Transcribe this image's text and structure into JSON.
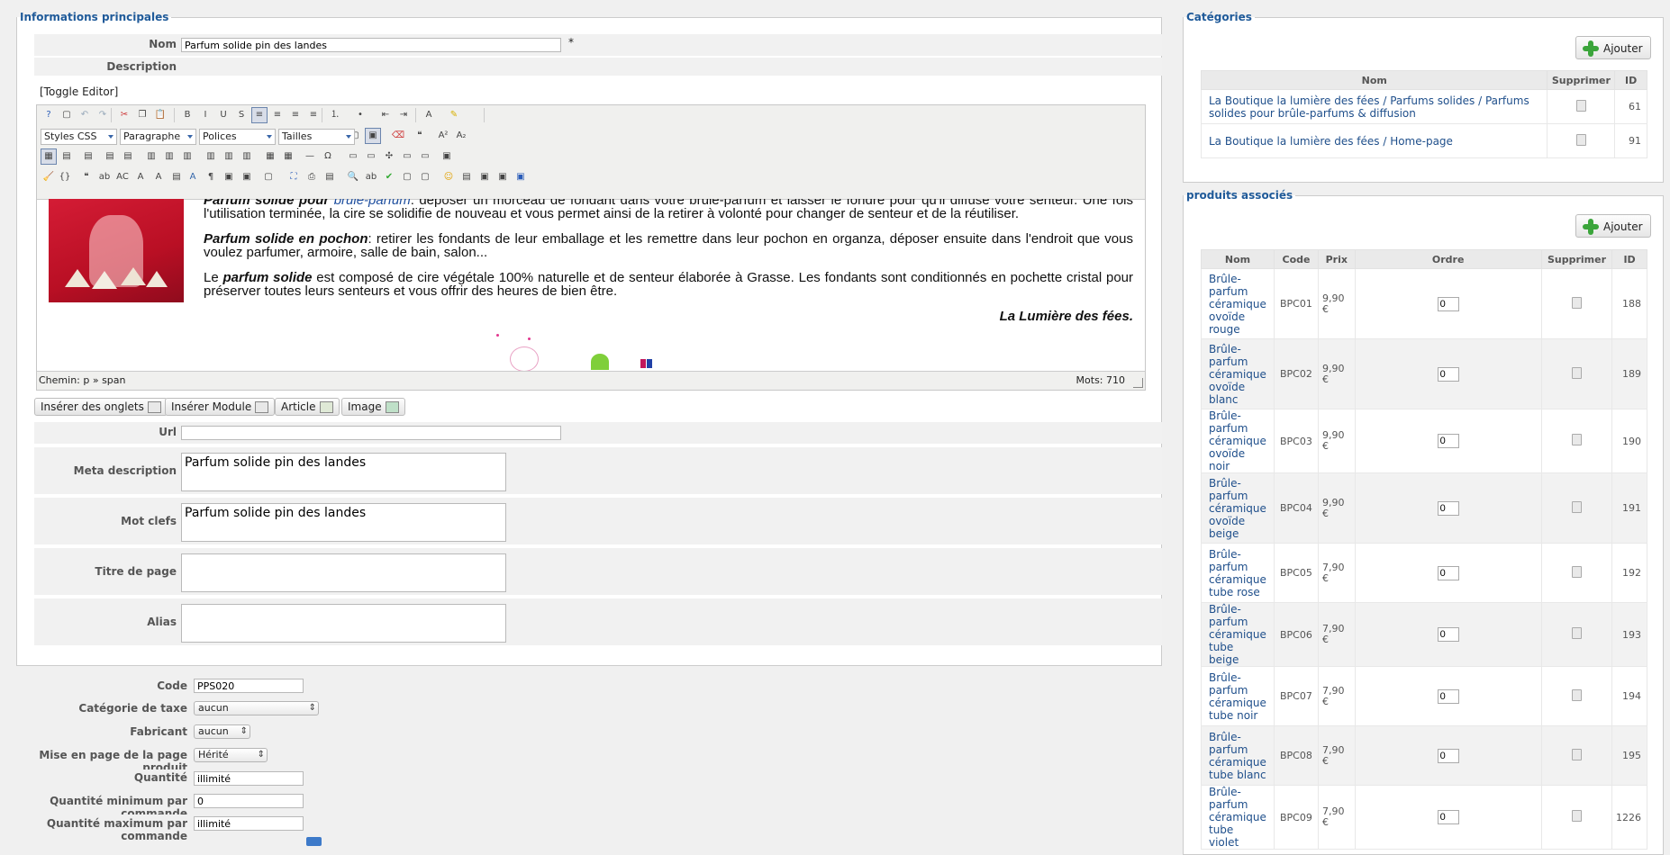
{
  "main": {
    "legend": "Informations principales",
    "nom_label": "Nom",
    "nom_value": "Parfum solide pin des landes",
    "required_mark": "*",
    "description_label": "Description",
    "toggle_editor": "[Toggle Editor]",
    "toolbar_selects": {
      "styles": "Styles CSS",
      "format": "Paragraphe",
      "fonts": "Polices",
      "sizes": "Tailles"
    },
    "content": {
      "p1_bold": "Parfum solide pour ",
      "p1_link": "brûle-parfum",
      "p1_rest": ": déposer un morceau de fondant dans votre brûle-parfum et laisser le fondre pour qu'il diffuse votre senteur. Une fois l'utilisation terminée, la cire se solidifie de nouveau et vous permet ainsi de la retirer à volonté pour changer de senteur et de la réutiliser.",
      "p2_bold": "Parfum solide en pochon",
      "p2_rest": ": retirer les fondants de leur emballage et les remettre dans leur pochon en organza, déposer ensuite dans l'endroit que vous voulez parfumer, armoire, salle de bain, salon...",
      "p3_a": "Le ",
      "p3_bold": "parfum solide",
      "p3_rest": " est composé de cire végétale 100% naturelle et de senteur élaborée à Grasse. Les fondants sont conditionnés en pochette cristal pour préserver toutes leurs senteurs et vous offrir des heures de bien être.",
      "signature": "La Lumière des fées."
    },
    "status_path": "Chemin: p » span",
    "word_count": "Mots: 710",
    "insert_buttons": [
      "Insérer des onglets",
      "Insérer Module",
      "Article",
      "Image"
    ],
    "url_label": "Url",
    "url_value": "",
    "meta_description_label": "Meta description",
    "meta_description_value": "Parfum solide pin des landes",
    "keywords_label": "Mot clefs",
    "keywords_value": "Parfum solide pin des landes",
    "page_title_label": "Titre de page",
    "page_title_value": "",
    "alias_label": "Alias",
    "alias_value": ""
  },
  "details": {
    "code_label": "Code",
    "code_value": "PPS020",
    "tax_label": "Catégorie de taxe",
    "tax_value": "aucun",
    "maker_label": "Fabricant",
    "maker_value": "aucun",
    "layout_label": "Mise en page de la page produit",
    "layout_value": "Hérité",
    "qty_label": "Quantité",
    "qty_value": "illimité",
    "qty_min_label": "Quantité minimum par commande",
    "qty_min_value": "0",
    "qty_max_label": "Quantité maximum par commande",
    "qty_max_value": "illimité"
  },
  "categories": {
    "legend": "Catégories",
    "add_label": "Ajouter",
    "headers": [
      "Nom",
      "Supprimer",
      "ID"
    ],
    "rows": [
      {
        "name": "La Boutique la lumière des fées / Parfums solides / Parfums solides pour brûle-parfums & diffusion",
        "id": "61"
      },
      {
        "name": "La Boutique la lumière des fées / Home-page",
        "id": "91"
      }
    ]
  },
  "related": {
    "legend": "produits associés",
    "add_label": "Ajouter",
    "headers": [
      "Nom",
      "Code",
      "Prix",
      "Ordre",
      "Supprimer",
      "ID"
    ],
    "rows": [
      {
        "name": "Brûle-parfum céramique ovoïde rouge",
        "code": "BPC01",
        "price": "9,90 €",
        "order": "0",
        "id": "188"
      },
      {
        "name": "Brûle-parfum céramique ovoïde blanc",
        "code": "BPC02",
        "price": "9,90 €",
        "order": "0",
        "id": "189"
      },
      {
        "name": "Brûle-parfum céramique ovoïde noir",
        "code": "BPC03",
        "price": "9,90 €",
        "order": "0",
        "id": "190"
      },
      {
        "name": "Brûle-parfum céramique ovoïde beige",
        "code": "BPC04",
        "price": "9,90 €",
        "order": "0",
        "id": "191"
      },
      {
        "name": "Brûle-parfum céramique tube rose",
        "code": "BPC05",
        "price": "7,90 €",
        "order": "0",
        "id": "192"
      },
      {
        "name": "Brûle-parfum céramique tube beige",
        "code": "BPC06",
        "price": "7,90 €",
        "order": "0",
        "id": "193"
      },
      {
        "name": "Brûle-parfum céramique tube noir",
        "code": "BPC07",
        "price": "7,90 €",
        "order": "0",
        "id": "194"
      },
      {
        "name": "Brûle-parfum céramique tube blanc",
        "code": "BPC08",
        "price": "7,90 €",
        "order": "0",
        "id": "195"
      },
      {
        "name": "Brûle-parfum céramique tube violet",
        "code": "BPC09",
        "price": "7,90 €",
        "order": "0",
        "id": "1226"
      }
    ]
  }
}
